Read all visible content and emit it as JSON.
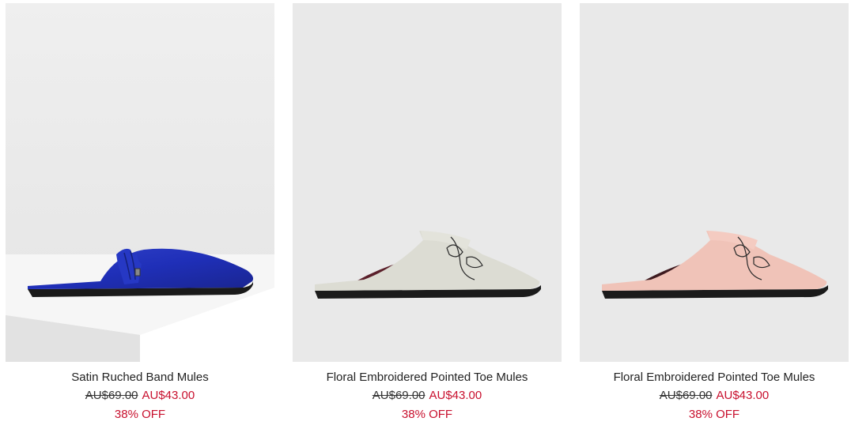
{
  "colors": {
    "sale_red": "#c8102e",
    "text_dark": "#222222",
    "photo_bg": "#e8e8e8"
  },
  "products": [
    {
      "name": "Satin Ruched Band Mules",
      "original_price": "AU$69.00",
      "sale_price": "AU$43.00",
      "discount": "38% OFF",
      "shoe_color": "blue satin"
    },
    {
      "name": "Floral Embroidered Pointed Toe Mules",
      "original_price": "AU$69.00",
      "sale_price": "AU$43.00",
      "discount": "38% OFF",
      "shoe_color": "grey"
    },
    {
      "name": "Floral Embroidered Pointed Toe Mules",
      "original_price": "AU$69.00",
      "sale_price": "AU$43.00",
      "discount": "38% OFF",
      "shoe_color": "pink"
    }
  ]
}
